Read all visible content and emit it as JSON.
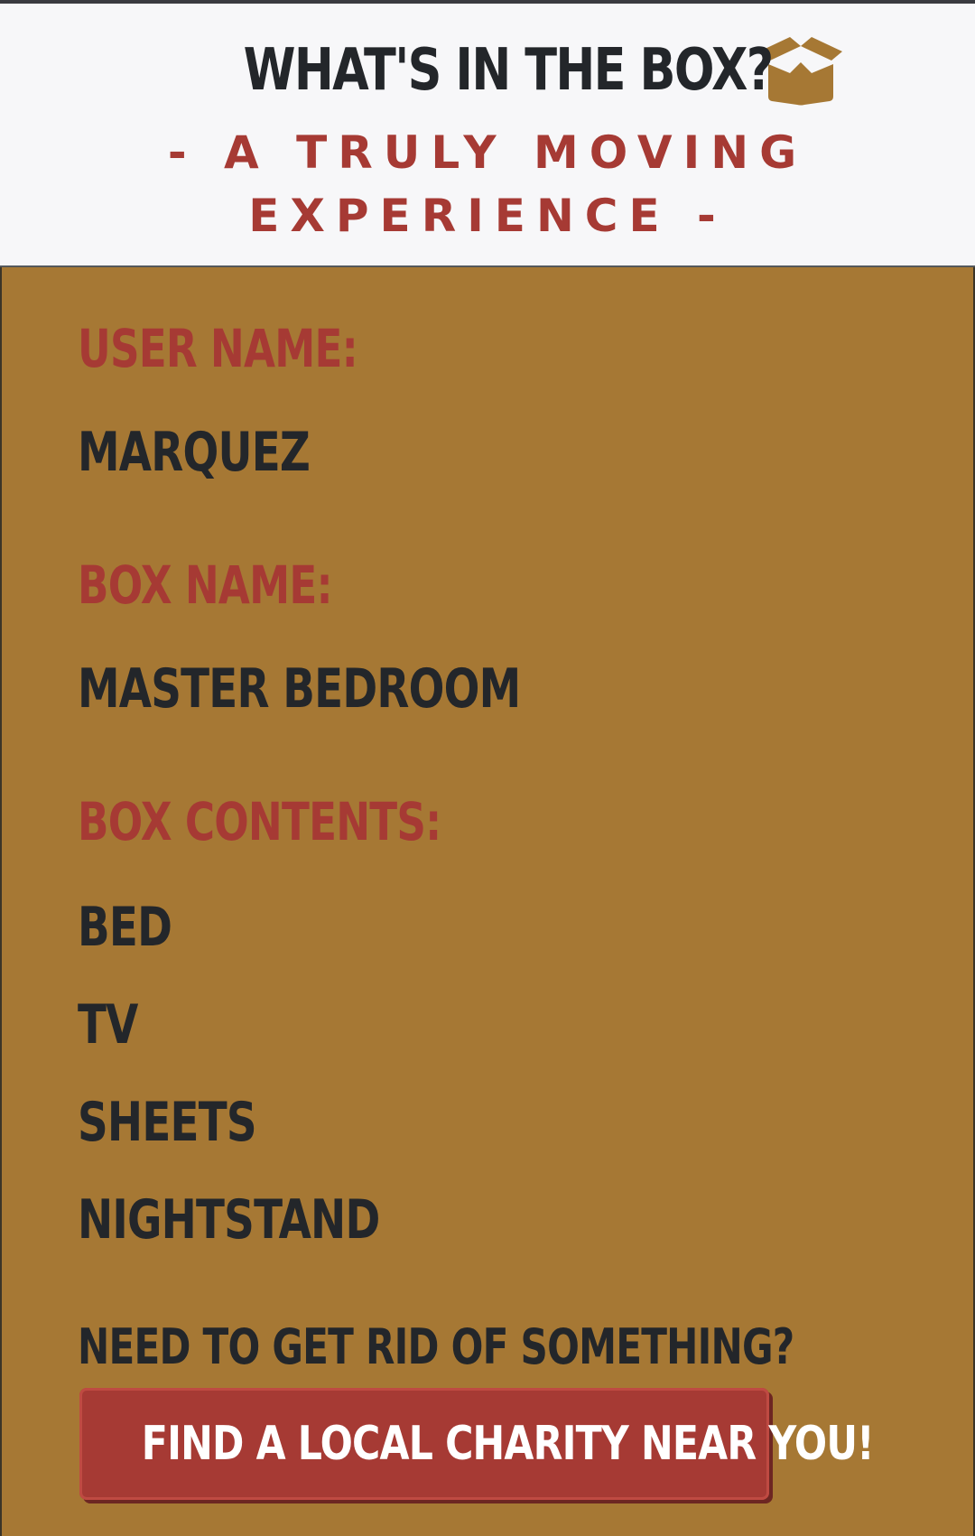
{
  "header": {
    "title": "WHAT'S IN THE BOX?",
    "icon": "open-box-icon",
    "subtitle_line1": "- A TRULY MOVING",
    "subtitle_line2": "EXPERIENCE -"
  },
  "details": {
    "user_name_label": "USER NAME:",
    "user_name_value": "MARQUEZ",
    "box_name_label": "BOX NAME:",
    "box_name_value": "MASTER BEDROOM",
    "box_contents_label": "BOX CONTENTS:",
    "contents": [
      "BED",
      "TV",
      "SHEETS",
      "NIGHTSTAND"
    ]
  },
  "charity": {
    "prompt": "NEED TO GET RID OF SOMETHING?",
    "button_label": "FIND A LOCAL CHARITY NEAR YOU!"
  },
  "colors": {
    "background": "#a67834",
    "header_bg": "#f7f7f9",
    "accent_red": "#a63a34",
    "text_dark": "#23262a",
    "box_icon": "#a67834"
  }
}
